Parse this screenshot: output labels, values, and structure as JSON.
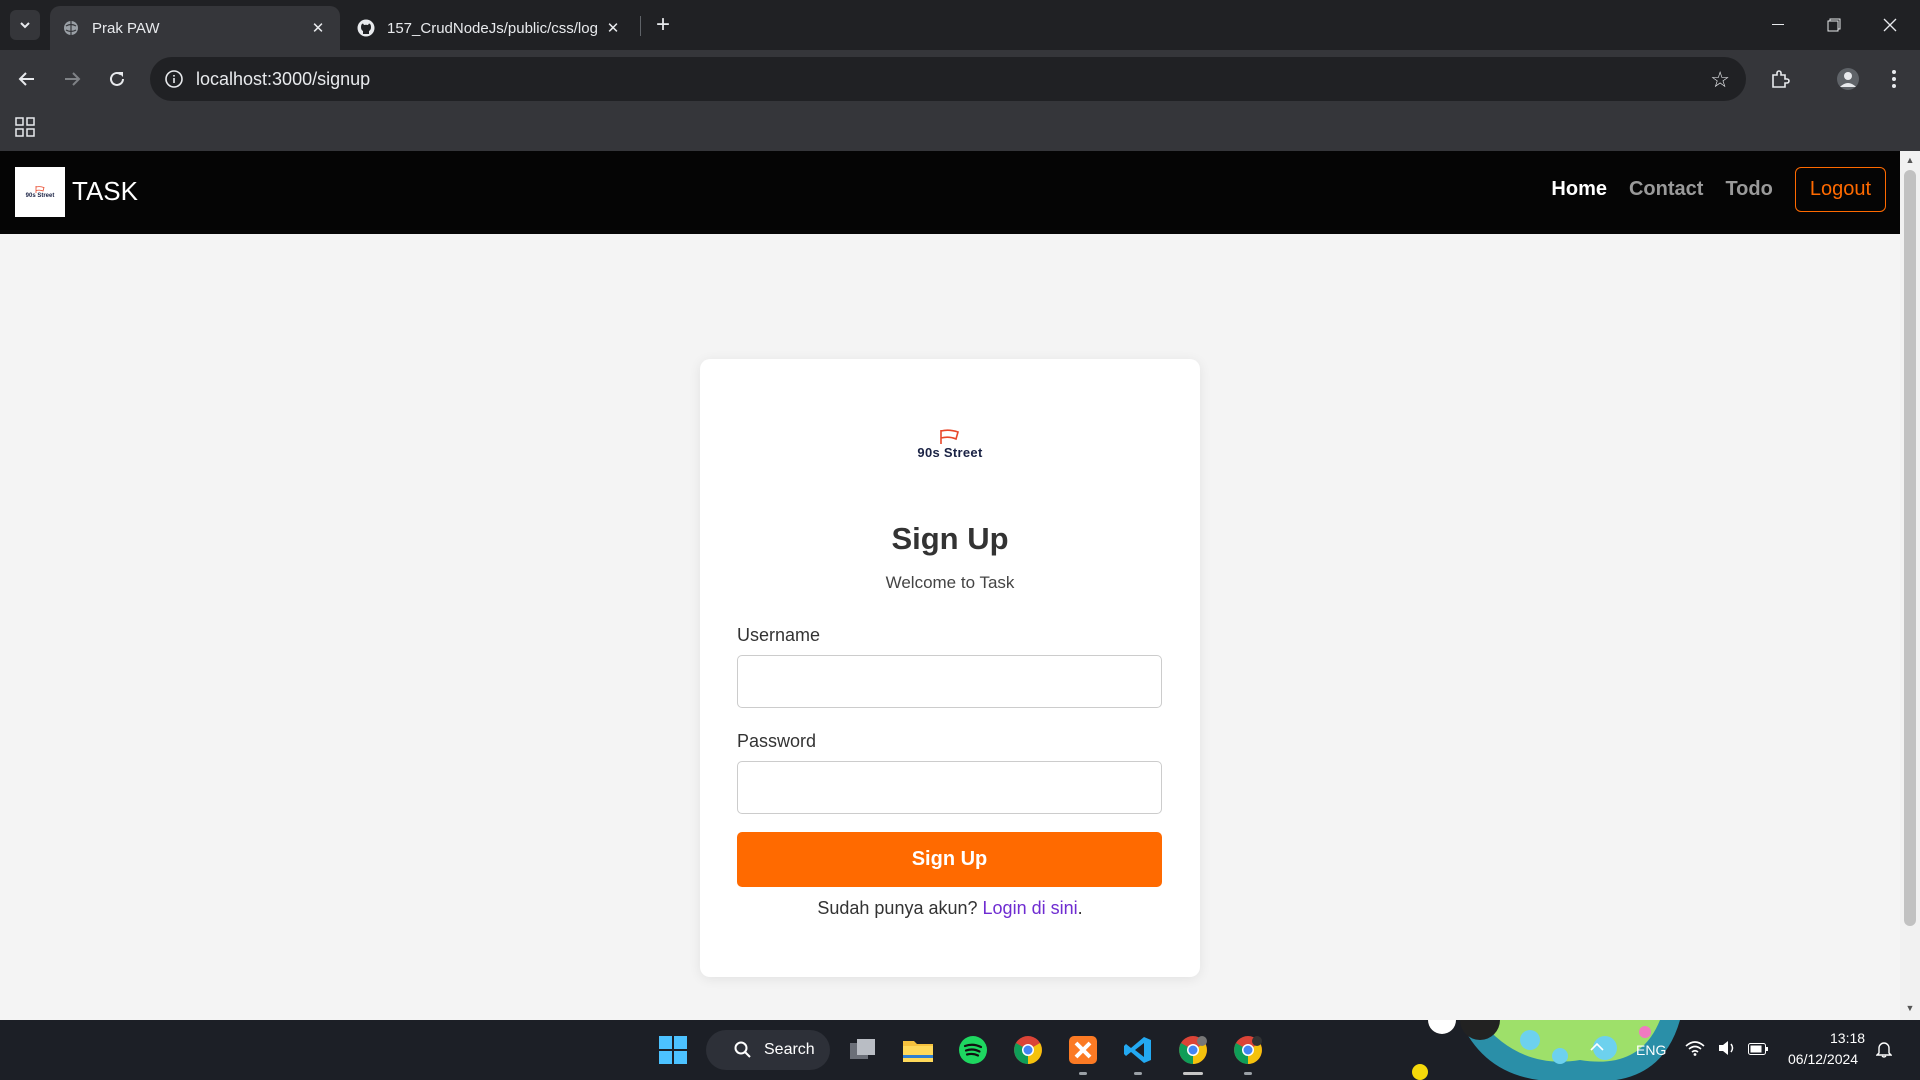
{
  "browser": {
    "tabs": [
      {
        "title": "Prak PAW",
        "active": true
      },
      {
        "title": "157_CrudNodeJs/public/css/log",
        "active": false
      }
    ],
    "url": "localhost:3000/signup"
  },
  "navbar": {
    "logo_text": "90s Street",
    "brand": "TASK",
    "links": [
      "Home",
      "Contact",
      "Todo"
    ],
    "logout": "Logout"
  },
  "signup": {
    "logo_text": "90s Street",
    "title": "Sign Up",
    "subtitle": "Welcome to Task",
    "username_label": "Username",
    "username_value": "",
    "password_label": "Password",
    "password_value": "",
    "submit_label": "Sign Up",
    "login_prompt": "Sudah punya akun?",
    "login_link": "Login di sini",
    "login_suffix": "."
  },
  "taskbar": {
    "search_label": "Search",
    "language": "ENG",
    "time": "13:18",
    "date": "06/12/2024"
  },
  "colors": {
    "accent": "#ff6a00",
    "link": "#6f2cd1",
    "navbar_bg": "#050505"
  },
  "icons": [
    "tab-search-icon",
    "globe-icon",
    "github-icon",
    "close-icon",
    "plus-icon",
    "minimize-icon",
    "restore-icon",
    "back-icon",
    "forward-icon",
    "reload-icon",
    "info-icon",
    "star-icon",
    "extensions-icon",
    "profile-icon",
    "menu-icon",
    "apps-icon",
    "windows-start-icon",
    "search-icon"
  ]
}
